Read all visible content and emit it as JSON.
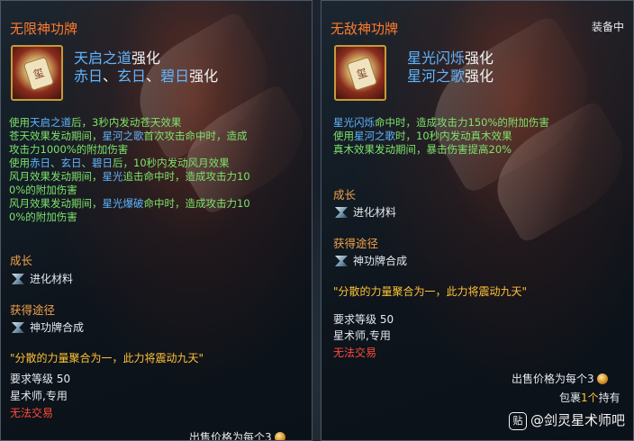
{
  "left_tooltip": {
    "title": "无限神功牌",
    "enhance_line1": {
      "skill": "天启之道",
      "suffix": "强化"
    },
    "enhance_line2": {
      "s1": "赤日",
      "sep1": "、",
      "s2": "玄日",
      "sep2": "、",
      "s3": "碧日",
      "suffix": "强化"
    },
    "desc": [
      [
        {
          "t": "使用",
          "c": "g"
        },
        {
          "t": "天启之道",
          "c": "b"
        },
        {
          "t": "后，3秒内发动苍天效果",
          "c": "g"
        }
      ],
      [
        {
          "t": "苍天效果发动期间，",
          "c": "g"
        },
        {
          "t": "星河之歌",
          "c": "b"
        },
        {
          "t": "首次攻击命中时，造成",
          "c": "g"
        }
      ],
      [
        {
          "t": "攻击力1000%的附加伤害",
          "c": "g"
        }
      ],
      [
        {
          "t": "使用",
          "c": "g"
        },
        {
          "t": "赤日",
          "c": "b"
        },
        {
          "t": "、",
          "c": "g"
        },
        {
          "t": "玄日",
          "c": "b"
        },
        {
          "t": "、",
          "c": "g"
        },
        {
          "t": "碧日",
          "c": "b"
        },
        {
          "t": "后，10秒内发动风月效果",
          "c": "g"
        }
      ],
      [
        {
          "t": "风月效果发动期间，",
          "c": "g"
        },
        {
          "t": "星光",
          "c": "b"
        },
        {
          "t": "追击命中时，造成攻击力10",
          "c": "g"
        }
      ],
      [
        {
          "t": "0%的附加伤害",
          "c": "g"
        }
      ],
      [
        {
          "t": "风月效果发动期间，",
          "c": "g"
        },
        {
          "t": "星光爆破",
          "c": "b"
        },
        {
          "t": "命中时，造成攻击力10",
          "c": "g"
        }
      ],
      [
        {
          "t": "0%的附加伤害",
          "c": "g"
        }
      ]
    ],
    "growth_header": "成长",
    "growth_item": "进化材料",
    "obtain_header": "获得途径",
    "obtain_item": "神功牌合成",
    "quote": "\"分散的力量聚合为一，此力将震动九天\"",
    "level_req": "要求等级 50",
    "class_req": "星术师,专用",
    "trade": "无法交易",
    "sell_price": "出售价格为每个3"
  },
  "right_tooltip": {
    "title": "无敌神功牌",
    "equipped": "装备中",
    "enhance_line1": {
      "skill": "星光闪烁",
      "suffix": "强化"
    },
    "enhance_line2": {
      "skill": "星河之歌",
      "suffix": "强化"
    },
    "desc": [
      [
        {
          "t": "星光闪烁",
          "c": "b"
        },
        {
          "t": "命中时，造成攻击力150%的附加伤害",
          "c": "g"
        }
      ],
      [
        {
          "t": "使用",
          "c": "g"
        },
        {
          "t": "星河之歌",
          "c": "b"
        },
        {
          "t": "时，10秒内发动真木效果",
          "c": "g"
        }
      ],
      [
        {
          "t": "真木效果发动期间，暴击伤害提高20%",
          "c": "g"
        }
      ]
    ],
    "growth_header": "成长",
    "growth_item": "进化材料",
    "obtain_header": "获得途径",
    "obtain_item": "神功牌合成",
    "quote": "\"分散的力量聚合为一，此力将震动九天\"",
    "level_req": "要求等级 50",
    "class_req": "星术师,专用",
    "trade": "无法交易",
    "sell_price": "出售价格为每个3",
    "inventory_prefix": "包裹",
    "inventory_count": "1个",
    "inventory_suffix": "持有"
  },
  "watermark": {
    "badge": "贴",
    "text": "@剑灵星术师吧"
  },
  "icon_glyph": "玺",
  "colors": {
    "title": "#ff7a2b",
    "skill": "#5fb6ff",
    "effect": "#7de36b",
    "section": "#f2a24a",
    "quote": "#ffc235",
    "warning": "#ff4a3a"
  }
}
